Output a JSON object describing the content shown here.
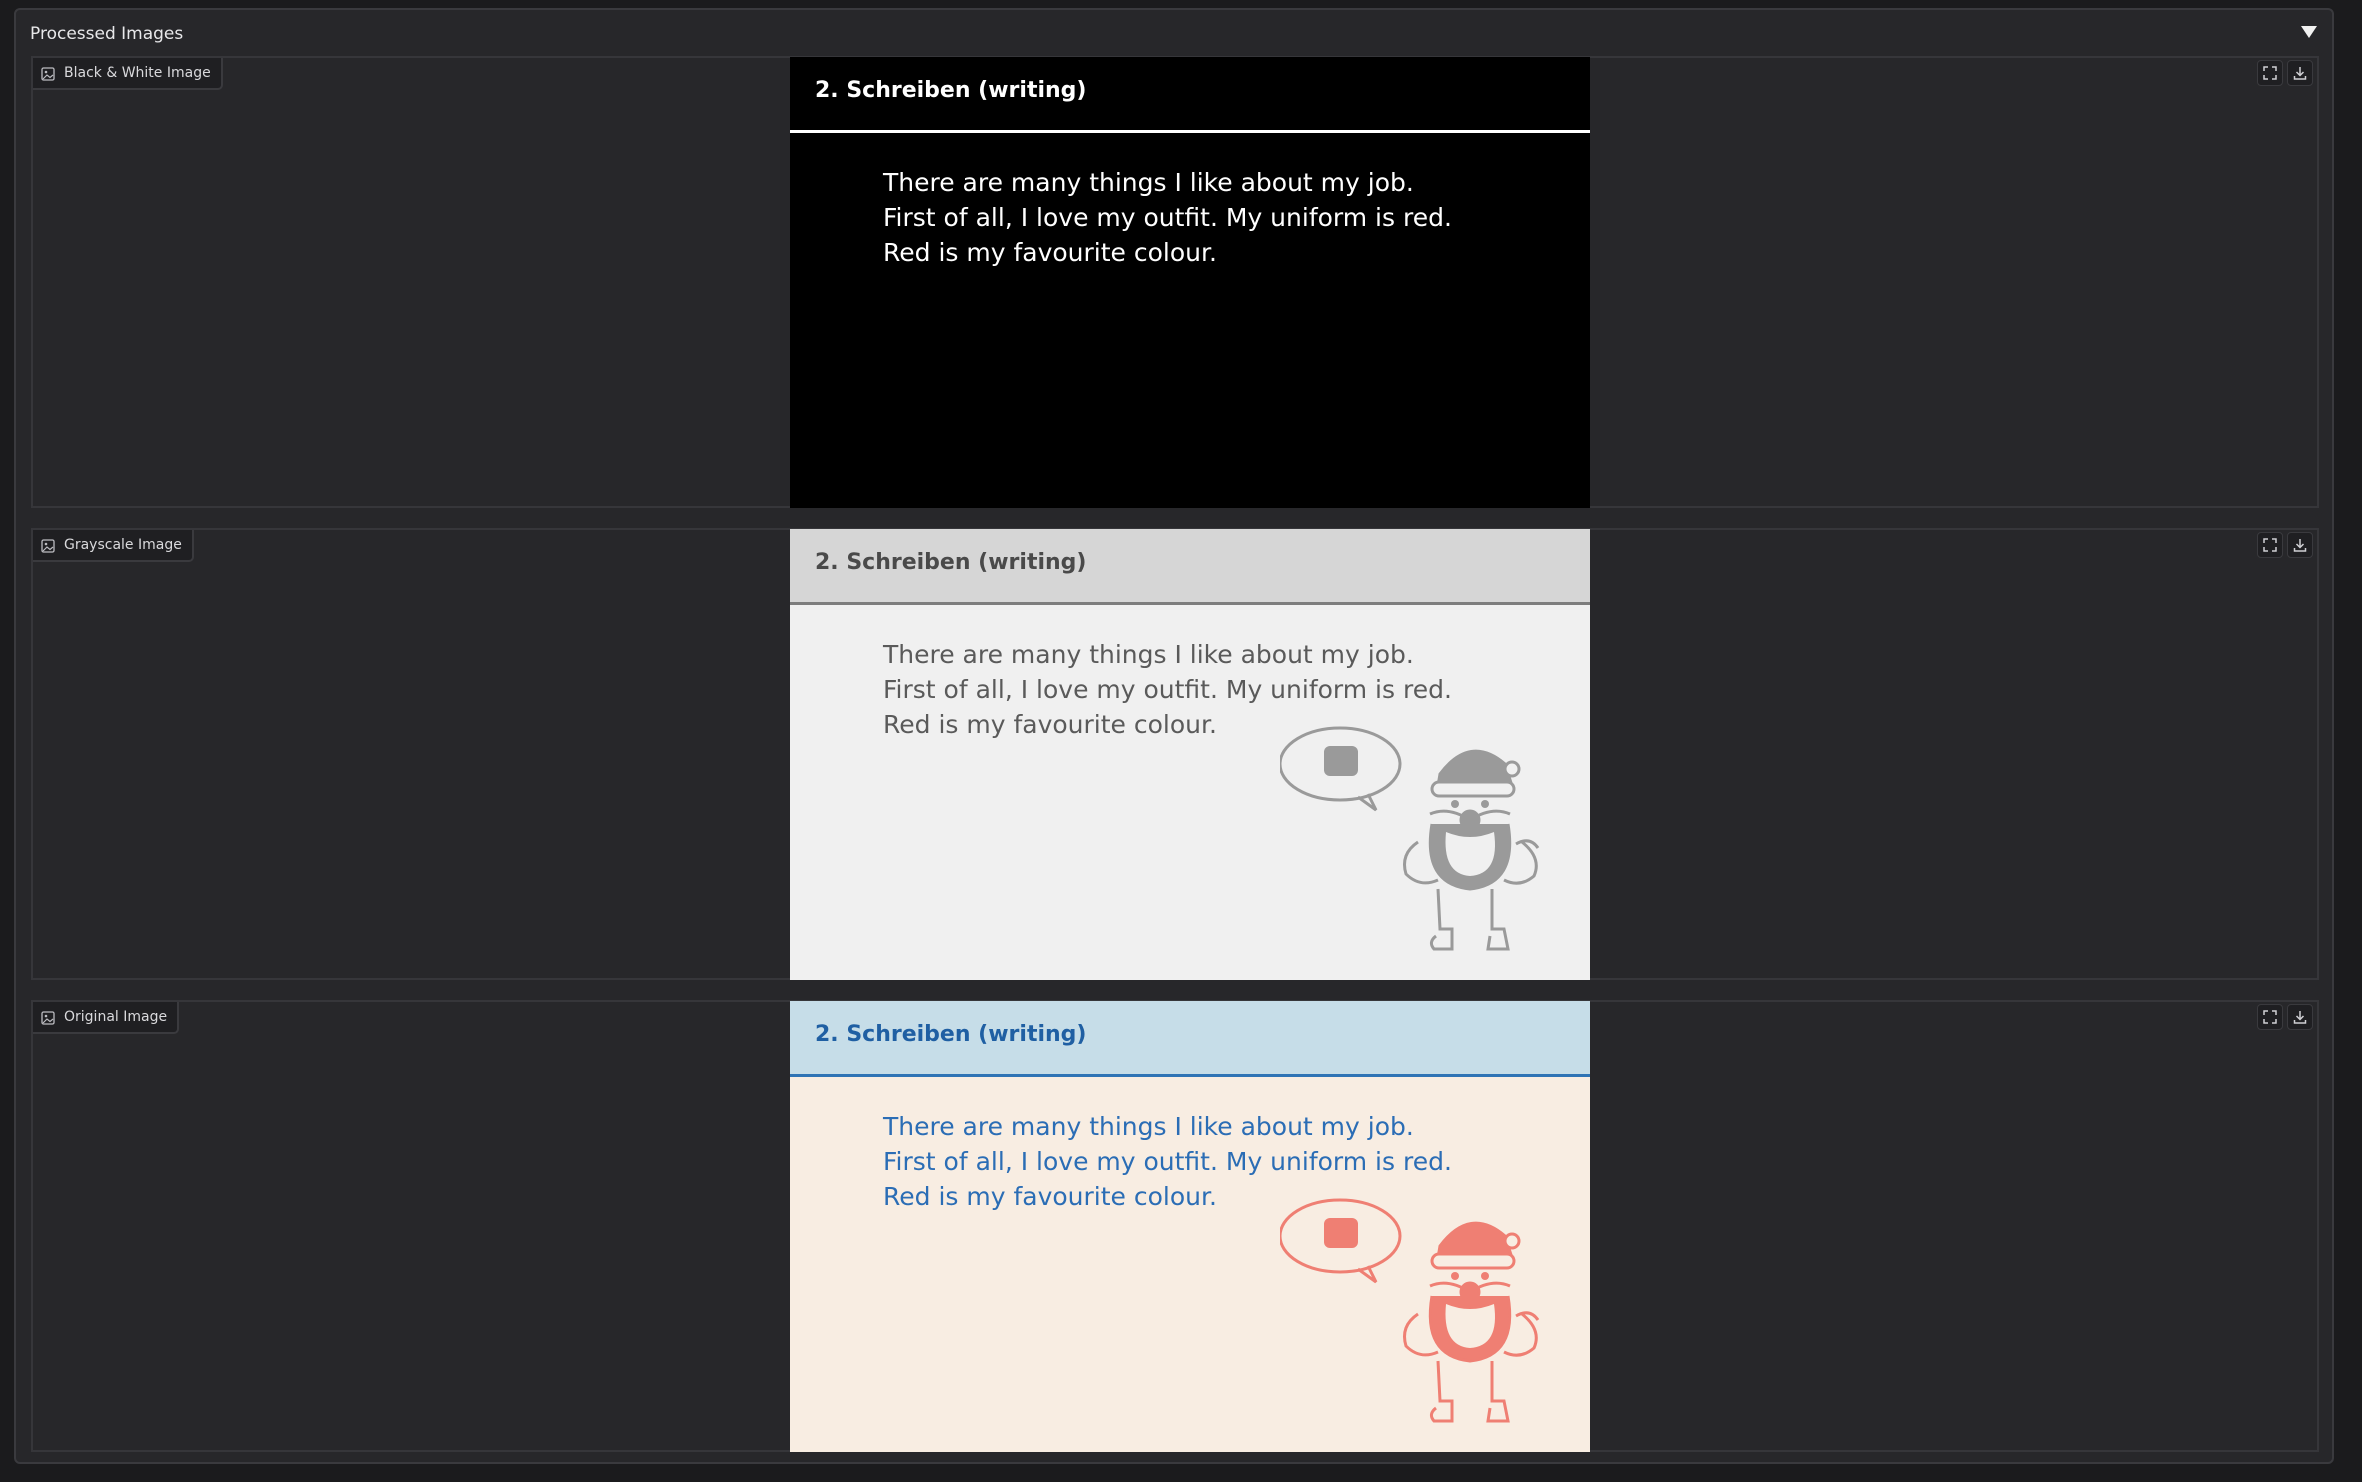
{
  "accordion": {
    "title": "Processed Images",
    "toggle_icon": "caret-down-icon"
  },
  "panels": [
    {
      "label": "Black & White Image",
      "label_icon": "image-icon",
      "actions": [
        "fullscreen-icon",
        "download-icon"
      ],
      "slide": {
        "title": "2. Schreiben (writing)",
        "lines": [
          "There are many things I like about my job.",
          "First of all, I love my outfit. My uniform is red.",
          "Red is my favourite colour."
        ]
      }
    },
    {
      "label": "Grayscale Image",
      "label_icon": "image-icon",
      "actions": [
        "fullscreen-icon",
        "download-icon"
      ],
      "slide": {
        "title": "2. Schreiben (writing)",
        "lines": [
          "There are many things I like about my job.",
          "First of all, I love my outfit. My uniform is red.",
          "Red is my favourite colour."
        ],
        "art_color": "#9a9a9a"
      }
    },
    {
      "label": "Original Image",
      "label_icon": "image-icon",
      "actions": [
        "fullscreen-icon",
        "download-icon"
      ],
      "slide": {
        "title": "2. Schreiben (writing)",
        "lines": [
          "There are many things I like about my job.",
          "First of all, I love my outfit. My uniform is red.",
          "Red is my favourite colour."
        ],
        "art_color": "#ef7f73"
      }
    }
  ]
}
